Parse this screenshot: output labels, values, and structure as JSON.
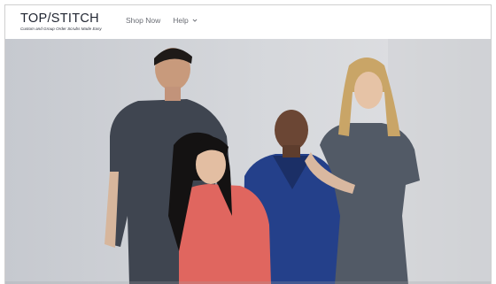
{
  "brand": {
    "name": "TOP STITCH",
    "name_display": "TOP/STITCH",
    "tagline": "Custom and Group Order Scrubs Made Easy"
  },
  "nav": {
    "items": [
      {
        "label": "Shop Now",
        "has_dropdown": false
      },
      {
        "label": "Help",
        "has_dropdown": true
      }
    ]
  },
  "hero": {
    "image_description": "Four models wearing medical scrubs in charcoal, coral, royal blue and grey on a light grey studio background",
    "colors": {
      "background": "#d3d5da",
      "charcoal_scrubs": "#3f4550",
      "coral_scrubs": "#e0665f",
      "royal_scrubs": "#24408a",
      "grey_scrubs": "#525a66"
    }
  }
}
